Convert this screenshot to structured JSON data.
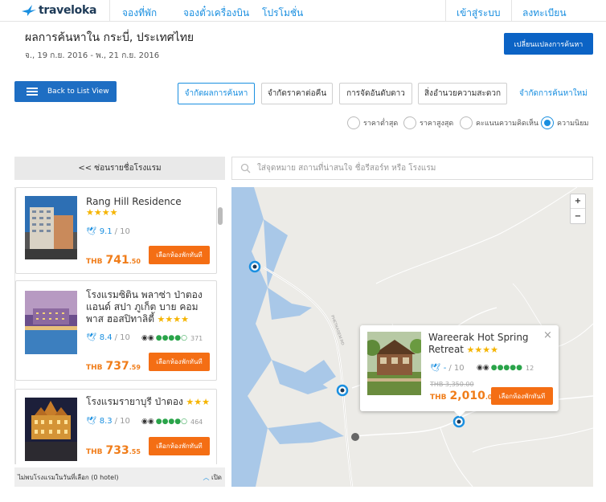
{
  "brand": {
    "name": "traveloka",
    "color": "#1a8fe0"
  },
  "nav": {
    "hotels": "จองที่พัก",
    "flights": "จองตั๋วเครื่องบิน",
    "promotions": "โปรโมชั่น",
    "login": "เข้าสู่ระบบ",
    "register": "ลงทะเบียน"
  },
  "search_summary": {
    "title": "ผลการค้นหาใน กระบี่, ประเทศไทย",
    "dates": "จ., 19 ก.ย. 2016 - พ., 21 ก.ย. 2016",
    "change_button": "เปลี่ยนแปลงการค้นหา"
  },
  "toolbar": {
    "back_to_list": "Back to List View",
    "filters": [
      {
        "label": "จำกัดผลการค้นหา",
        "active": true
      },
      {
        "label": "จำกัดราคาต่อคืน",
        "active": false
      },
      {
        "label": "การจัดอันดับดาว",
        "active": false
      },
      {
        "label": "สิ่งอำนวยความสะดวก",
        "active": false
      }
    ],
    "reset": "จำกัดการค้นหาใหม่"
  },
  "sort": {
    "options": [
      {
        "label": "ราคาต่ำสุด",
        "selected": false
      },
      {
        "label": "ราคาสูงสุด",
        "selected": false
      },
      {
        "label": "คะแนนความคิดเห็น",
        "selected": false
      },
      {
        "label": "ความนิยม",
        "selected": true
      }
    ]
  },
  "list": {
    "hide_label": "<<   ซ่อนรายชื่อโรงแรม",
    "hotels": [
      {
        "name": "Rang Hill Residence",
        "stars": 4,
        "score": "9.1",
        "out_of": "/ 10",
        "currency": "THB",
        "price": "741",
        "price_dec": ".50",
        "book": "เลือกห้องพักทันที"
      },
      {
        "name": "โรงแรมซิติน พลาซ่า ป่าตอง แอนด์ สปา ภูเก็ต บาย คอมพาส ฮอสปิทาลิตี้",
        "stars": 4,
        "score": "8.4",
        "out_of": "/ 10",
        "ta_count": "371",
        "currency": "THB",
        "price": "737",
        "price_dec": ".59",
        "book": "เลือกห้องพักทันที"
      },
      {
        "name": "โรงแรมรายาบุรี ป่าตอง",
        "stars": 3,
        "score": "8.3",
        "out_of": "/ 10",
        "ta_count": "464",
        "currency": "THB",
        "price": "733",
        "price_dec": ".55",
        "book": "เลือกห้องพักทันที"
      }
    ],
    "no_result": "ไม่พบโรงแรมในวันที่เลือก (0 hotel)",
    "open": "เปิด"
  },
  "map_search": {
    "placeholder": "ใส่จุดหมาย สถานที่น่าสนใจ ชื่อรีสอร์ท หรือ โรงแรม"
  },
  "map": {
    "zoom_in": "+",
    "zoom_out": "−",
    "road_label": "PHETKASEM RD"
  },
  "popup": {
    "name": "Wareerak Hot Spring Retreat",
    "stars": 4,
    "score": "-",
    "out_of": "/ 10",
    "ta_count": "12",
    "old_price": "THB 3,350.00",
    "currency": "THB",
    "price": "2,010",
    "price_dec": ".00",
    "book": "เลือกห้องพักทันที",
    "close": "×"
  },
  "colors": {
    "primary": "#0b63c5",
    "accent": "#f46e14",
    "link": "#1a8fe0",
    "star": "#f5b400",
    "tripadvisor": "#2aa44a"
  }
}
